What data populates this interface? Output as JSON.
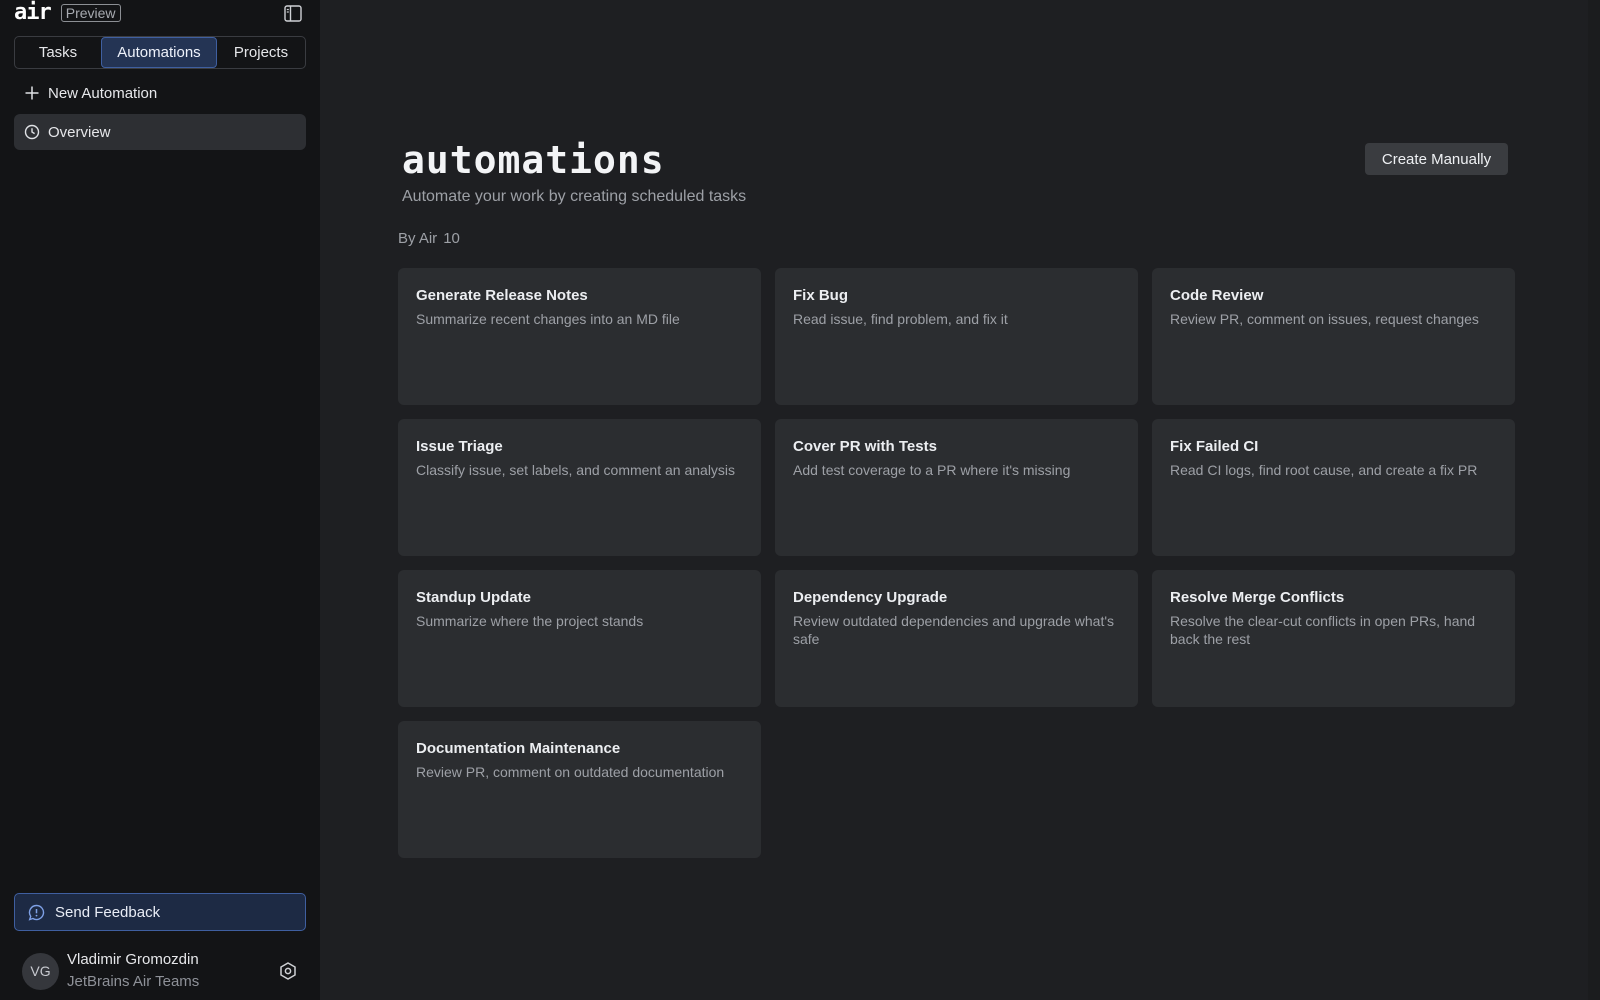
{
  "brand": {
    "logo_text": "air",
    "badge": "Preview"
  },
  "sidebar": {
    "tabs": [
      {
        "label": "Tasks",
        "active": false
      },
      {
        "label": "Automations",
        "active": true
      },
      {
        "label": "Projects",
        "active": false
      }
    ],
    "new_automation_label": "New Automation",
    "overview_label": "Overview",
    "feedback_label": "Send Feedback",
    "user": {
      "initials": "VG",
      "name": "Vladimir Gromozdin",
      "org": "JetBrains Air Teams"
    }
  },
  "main": {
    "title": "automations",
    "subtitle": "Automate your work by creating scheduled tasks",
    "create_button": "Create Manually",
    "section": {
      "label": "By Air",
      "count": "10"
    },
    "cards": [
      {
        "title": "Generate Release Notes",
        "desc": "Summarize recent changes into an MD file"
      },
      {
        "title": "Fix Bug",
        "desc": "Read issue, find problem, and fix it"
      },
      {
        "title": "Code Review",
        "desc": "Review PR, comment on issues, request changes"
      },
      {
        "title": "Issue Triage",
        "desc": "Classify issue, set labels, and comment an analysis"
      },
      {
        "title": "Cover PR with Tests",
        "desc": "Add test coverage to a PR where it's missing"
      },
      {
        "title": "Fix Failed CI",
        "desc": "Read CI logs, find root cause, and create a fix PR"
      },
      {
        "title": "Standup Update",
        "desc": "Summarize where the project stands"
      },
      {
        "title": "Dependency Upgrade",
        "desc": "Review outdated dependencies and upgrade what's safe"
      },
      {
        "title": "Resolve Merge Conflicts",
        "desc": "Resolve the clear-cut conflicts in open PRs, hand back the rest"
      },
      {
        "title": "Documentation Maintenance",
        "desc": "Review PR, comment on outdated documentation"
      }
    ]
  },
  "colors": {
    "sidebar_bg": "#131416",
    "main_bg": "#1e1f22",
    "card_bg": "#2b2d30",
    "accent": "#3f5fa0",
    "accent_bg": "#243454"
  },
  "icons": [
    "panel-toggle-icon",
    "plus-icon",
    "clock-icon",
    "feedback-icon",
    "settings-icon"
  ]
}
